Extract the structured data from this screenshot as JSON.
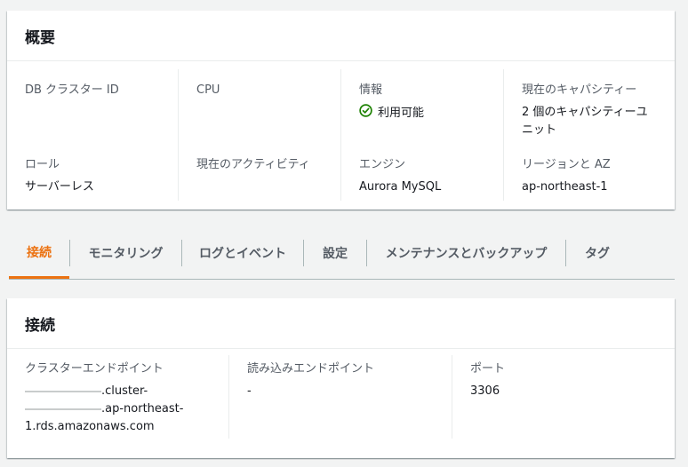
{
  "overview": {
    "title": "概要",
    "fields": [
      {
        "label": "DB クラスター ID",
        "value": ""
      },
      {
        "label": "CPU",
        "value": ""
      },
      {
        "label": "情報",
        "value": "利用可能"
      },
      {
        "label": "現在のキャパシティー",
        "value": "2 個のキャパシティーユニット"
      },
      {
        "label": "ロール",
        "value": "サーバーレス"
      },
      {
        "label": "現在のアクティビティ",
        "value": ""
      },
      {
        "label": "エンジン",
        "value": "Aurora MySQL"
      },
      {
        "label": "リージョンと AZ",
        "value": "ap-northeast-1"
      }
    ]
  },
  "tabs": [
    {
      "label": "接続",
      "active": true
    },
    {
      "label": "モニタリング",
      "active": false
    },
    {
      "label": "ログとイベント",
      "active": false
    },
    {
      "label": "設定",
      "active": false
    },
    {
      "label": "メンテナンスとバックアップ",
      "active": false
    },
    {
      "label": "タグ",
      "active": false
    }
  ],
  "connection": {
    "title": "接続",
    "cluster_endpoint_label": "クラスターエンドポイント",
    "cluster_endpoint_lines": [
      ".cluster-",
      ".ap-northeast-",
      "1.rds.amazonaws.com"
    ],
    "reader_endpoint_label": "読み込みエンドポイント",
    "reader_endpoint_value": "-",
    "port_label": "ポート",
    "port_value": "3306"
  },
  "colors": {
    "accent": "#ec7211",
    "status_ok": "#1d8102",
    "label": "#545b64",
    "text": "#16191f"
  }
}
